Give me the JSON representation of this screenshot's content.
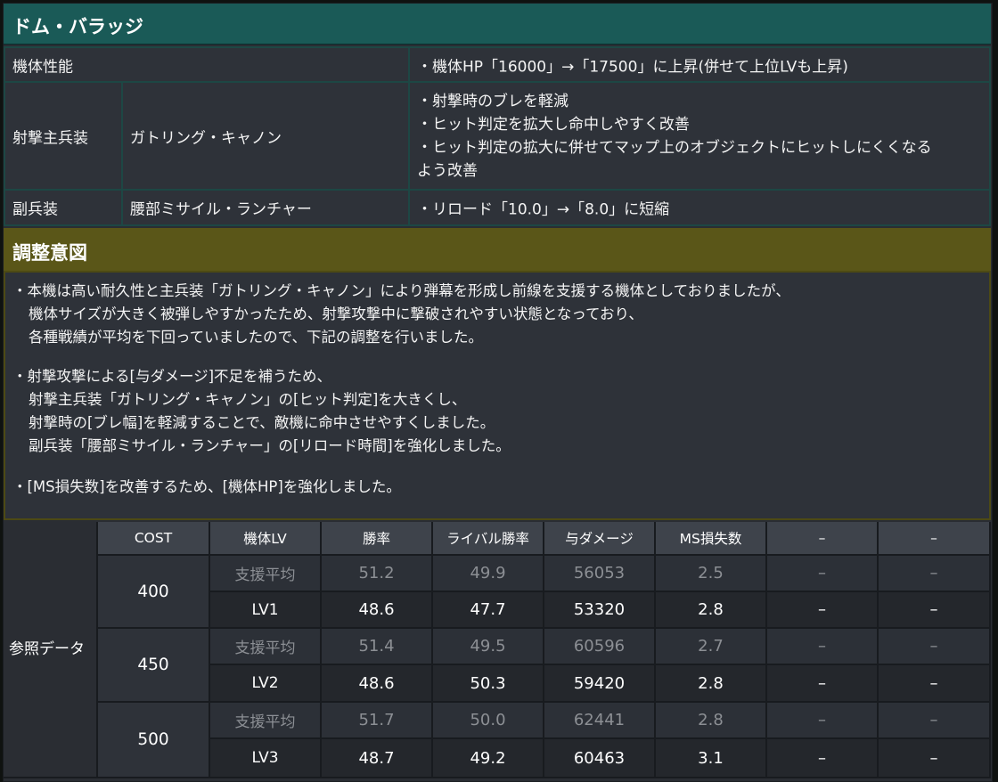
{
  "title": "ドム・バラッジ",
  "changes": {
    "hp": {
      "category": "機体性能",
      "detail": "・機体HP「16000」→「17500」に上昇(併せて上位LVも上昇)"
    },
    "main_weapon": {
      "category": "射撃主兵装",
      "weapon": "ガトリング・キャノン",
      "lines": [
        "・射撃時のブレを軽減",
        "・ヒット判定を拡大し命中しやすく改善",
        "・ヒット判定の拡大に併せてマップ上のオブジェクトにヒットしにくくなる",
        "よう改善"
      ]
    },
    "sub_weapon": {
      "category": "副兵装",
      "weapon": "腰部ミサイル・ランチャー",
      "detail": "・リロード「10.0」→「8.0」に短縮"
    }
  },
  "intent": {
    "heading": "調整意図",
    "paragraphs": [
      [
        "・本機は高い耐久性と主兵装「ガトリング・キャノン」により弾幕を形成し前線を支援する機体としておりましたが、",
        "機体サイズが大きく被弾しやすかったため、射撃攻撃中に撃破されやすい状態となっており、",
        "各種戦績が平均を下回っていましたので、下記の調整を行いました。"
      ],
      [
        "・射撃攻撃による[与ダメージ]不足を補うため、",
        "射撃主兵装「ガトリング・キャノン」の[ヒット判定]を大きくし、",
        "射撃時の[ブレ幅]を軽減することで、敵機に命中させやすくしました。",
        "副兵装「腰部ミサイル・ランチャー」の[リロード時間]を強化しました。"
      ],
      [
        "・[MS損失数]を改善するため、[機体HP]を強化しました。"
      ]
    ]
  },
  "reference": {
    "label": "参照データ",
    "headers": [
      "COST",
      "機体LV",
      "勝率",
      "ライバル勝率",
      "与ダメージ",
      "MS損失数",
      "–",
      "–"
    ],
    "groups": [
      {
        "cost": "400",
        "rows": [
          {
            "label": "支援平均",
            "win": "51.2",
            "rival": "49.9",
            "damage": "56053",
            "loss": "2.5",
            "c7": "–",
            "c8": "–"
          },
          {
            "label": "LV1",
            "win": "48.6",
            "rival": "47.7",
            "damage": "53320",
            "loss": "2.8",
            "c7": "–",
            "c8": "–"
          }
        ]
      },
      {
        "cost": "450",
        "rows": [
          {
            "label": "支援平均",
            "win": "51.4",
            "rival": "49.5",
            "damage": "60596",
            "loss": "2.7",
            "c7": "–",
            "c8": "–"
          },
          {
            "label": "LV2",
            "win": "48.6",
            "rival": "50.3",
            "damage": "59420",
            "loss": "2.8",
            "c7": "–",
            "c8": "–"
          }
        ]
      },
      {
        "cost": "500",
        "rows": [
          {
            "label": "支援平均",
            "win": "51.7",
            "rival": "50.0",
            "damage": "62441",
            "loss": "2.8",
            "c7": "–",
            "c8": "–"
          },
          {
            "label": "LV3",
            "win": "48.7",
            "rival": "49.2",
            "damage": "60463",
            "loss": "3.1",
            "c7": "–",
            "c8": "–"
          }
        ]
      }
    ]
  },
  "colors": {
    "title_bar": "#1a5a57",
    "intent_bar": "#5a5618",
    "panel": "#2e3239"
  }
}
